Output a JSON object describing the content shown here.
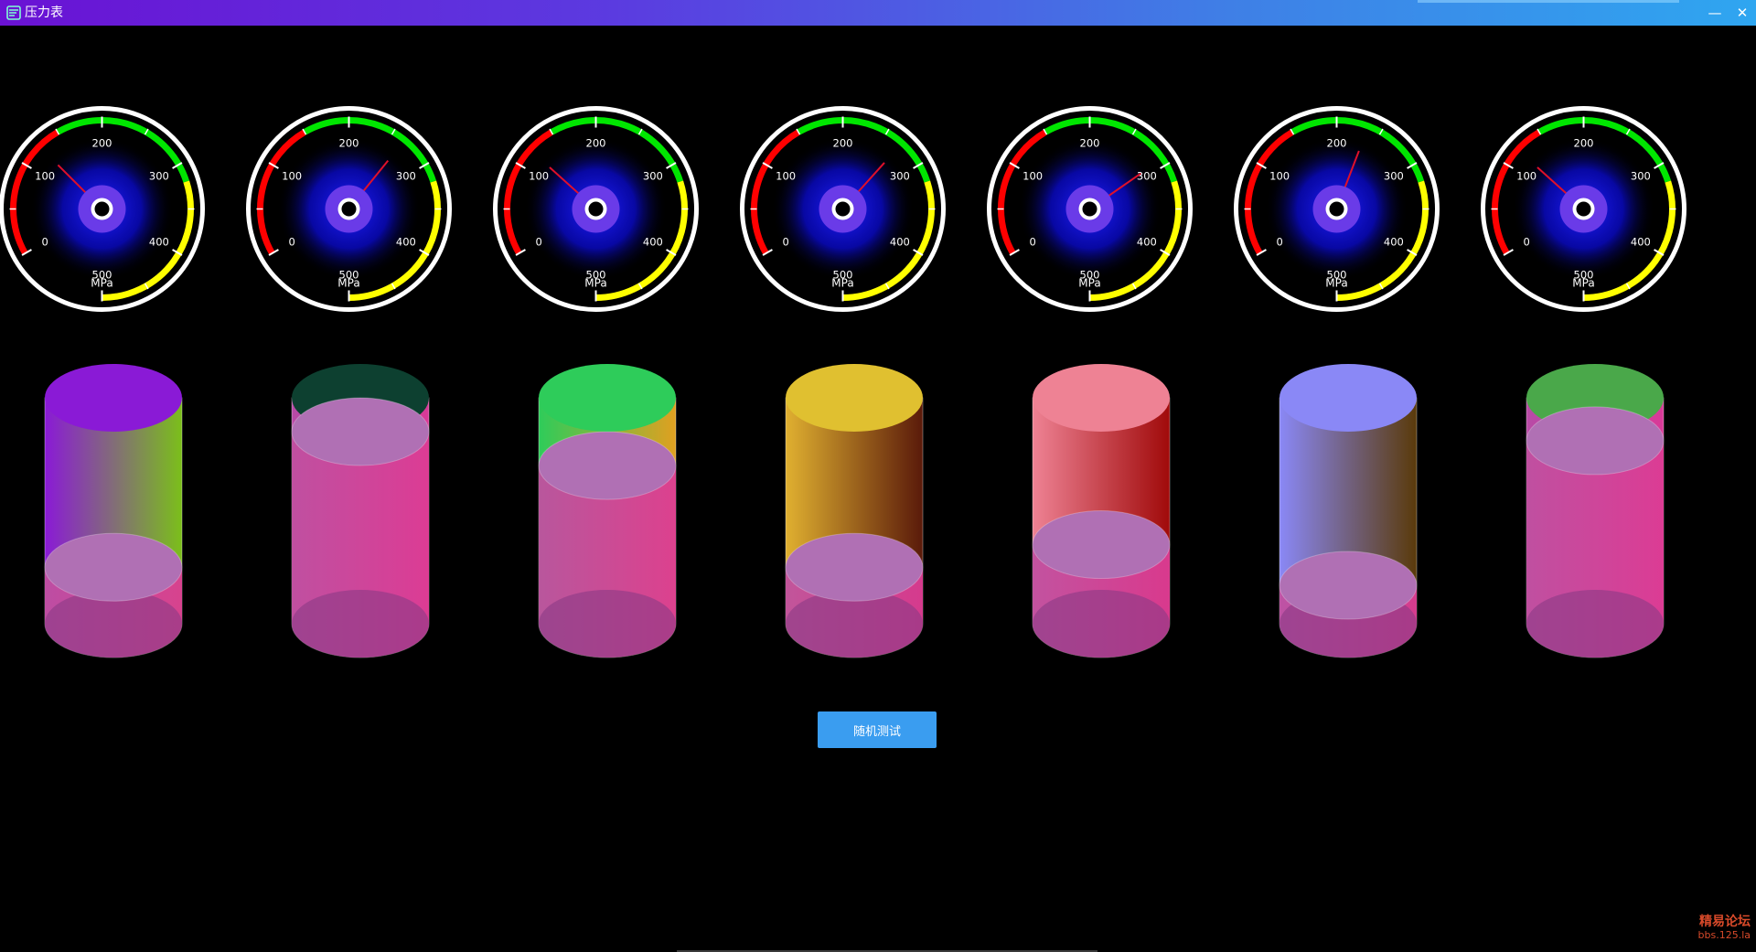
{
  "window": {
    "title": "压力表",
    "minimize_label": "—",
    "close_label": "✕"
  },
  "gauge_scale": {
    "min": 0,
    "max": 500,
    "tick_labels": [
      "0",
      "100",
      "200",
      "300",
      "400",
      "500"
    ],
    "unit": "MPa",
    "colors": {
      "low": "#ff0000",
      "mid": "#00e600",
      "high": "#ffff00",
      "ring": "#ffffff",
      "needle": "#e0102a",
      "glow": "#2020ff",
      "hub": "#6a3be8"
    }
  },
  "gauges": [
    {
      "value": 125
    },
    {
      "value": 265
    },
    {
      "value": 120
    },
    {
      "value": 270
    },
    {
      "value": 292
    },
    {
      "value": 235
    },
    {
      "value": 120
    }
  ],
  "cylinders": [
    {
      "level": 0.25,
      "colors": {
        "top": "#8a1ad6",
        "left": "#8a1ad6",
        "right": "#7bbf1a"
      }
    },
    {
      "level": 0.85,
      "colors": {
        "top": "#0d4030",
        "left": "#b84aa6",
        "right": "#d83a98"
      }
    },
    {
      "level": 0.7,
      "colors": {
        "top": "#2ecc5a",
        "left": "#2ecc5a",
        "right": "#e0a020"
      }
    },
    {
      "level": 0.25,
      "colors": {
        "top": "#e0c030",
        "left": "#e0b030",
        "right": "#5a1a0a"
      }
    },
    {
      "level": 0.35,
      "colors": {
        "top": "#ee8294",
        "left": "#ee8294",
        "right": "#a00a0a"
      }
    },
    {
      "level": 0.17,
      "colors": {
        "top": "#8a88f6",
        "left": "#8a88f6",
        "right": "#5a3a0a"
      }
    },
    {
      "level": 0.81,
      "colors": {
        "top": "#4aa84a",
        "left": "#b84aa6",
        "right": "#d83a98"
      }
    }
  ],
  "liquid_colors": {
    "surface": "#b070b4",
    "left": "#c050a0",
    "right": "#dc3c94"
  },
  "random_button": {
    "label": "随机测试"
  },
  "watermark": {
    "line1": "精易论坛",
    "line2": "bbs.125.la"
  }
}
